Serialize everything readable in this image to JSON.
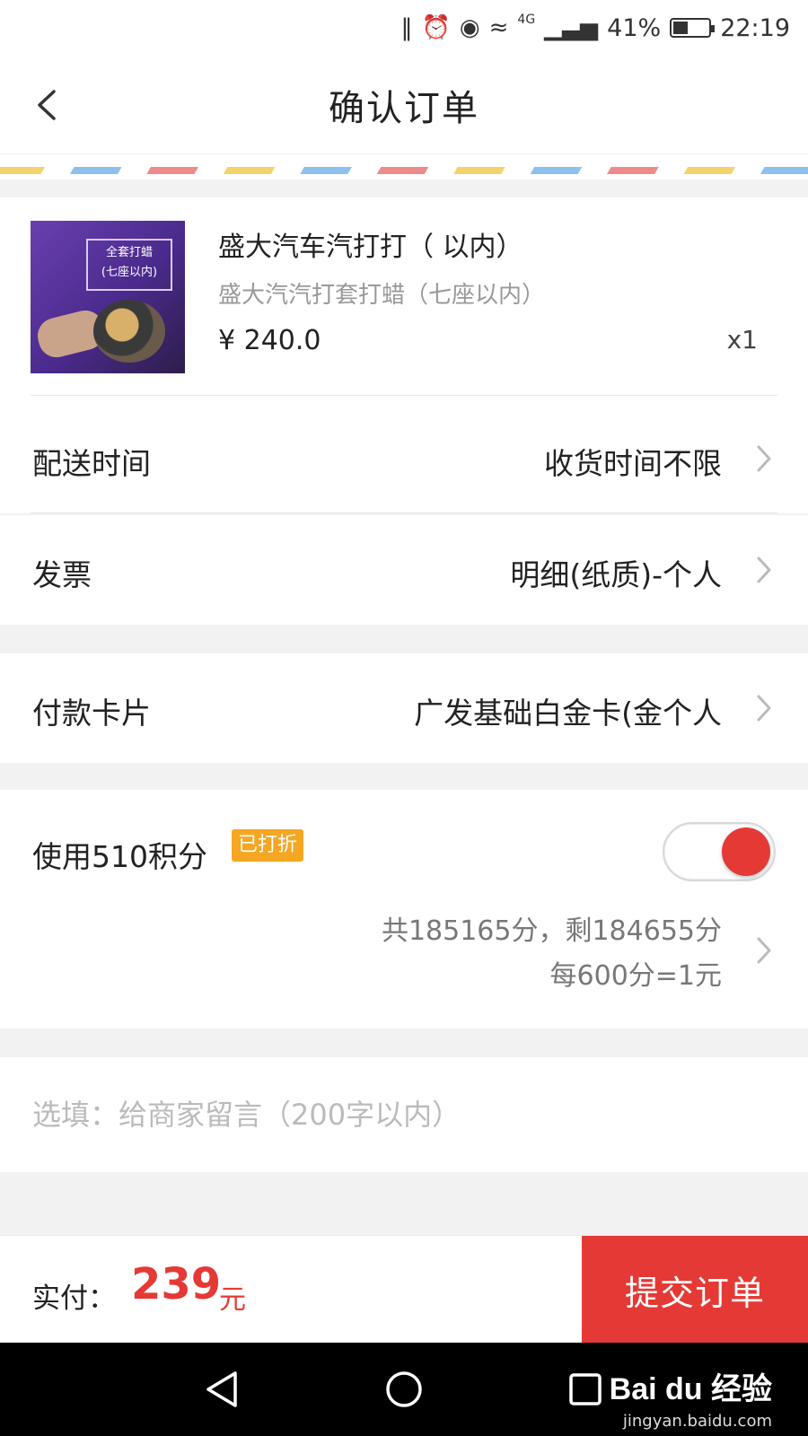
{
  "status_bar": {
    "battery": "41%",
    "battery_level": 0.41,
    "time": "22:19",
    "network": "4G"
  },
  "header": {
    "title": "确认订单"
  },
  "product": {
    "thumb_title": "全套打蜡",
    "thumb_sub": "(七座以内)",
    "name": "盛大汽车汽打打（        以内）",
    "subtitle": "盛大汽汽打套打蜡（七座以内）",
    "price": "¥ 240.0",
    "quantity": "x1"
  },
  "rows": {
    "delivery": {
      "label": "配送时间",
      "value": "收货时间不限"
    },
    "invoice": {
      "label": "发票",
      "value": "明细(纸质)-个人"
    },
    "payment_card": {
      "label": "付款卡片",
      "value": "广发基础白金卡(金个人"
    }
  },
  "points": {
    "label": "使用510积分",
    "badge": "已打折",
    "enabled": true,
    "balance": "共185165分，剩184655分",
    "rate": "每600分=1元"
  },
  "note": {
    "placeholder": "选填：给商家留言（200字以内）"
  },
  "footer": {
    "pay_label": "实付：",
    "amount": "239",
    "unit": "元",
    "submit_label": "提交订单"
  },
  "watermark": {
    "logo": "Bai du 经验",
    "url": "jingyan.baidu.com"
  },
  "colors": {
    "accent": "#e53935",
    "badge": "#f5a623"
  }
}
